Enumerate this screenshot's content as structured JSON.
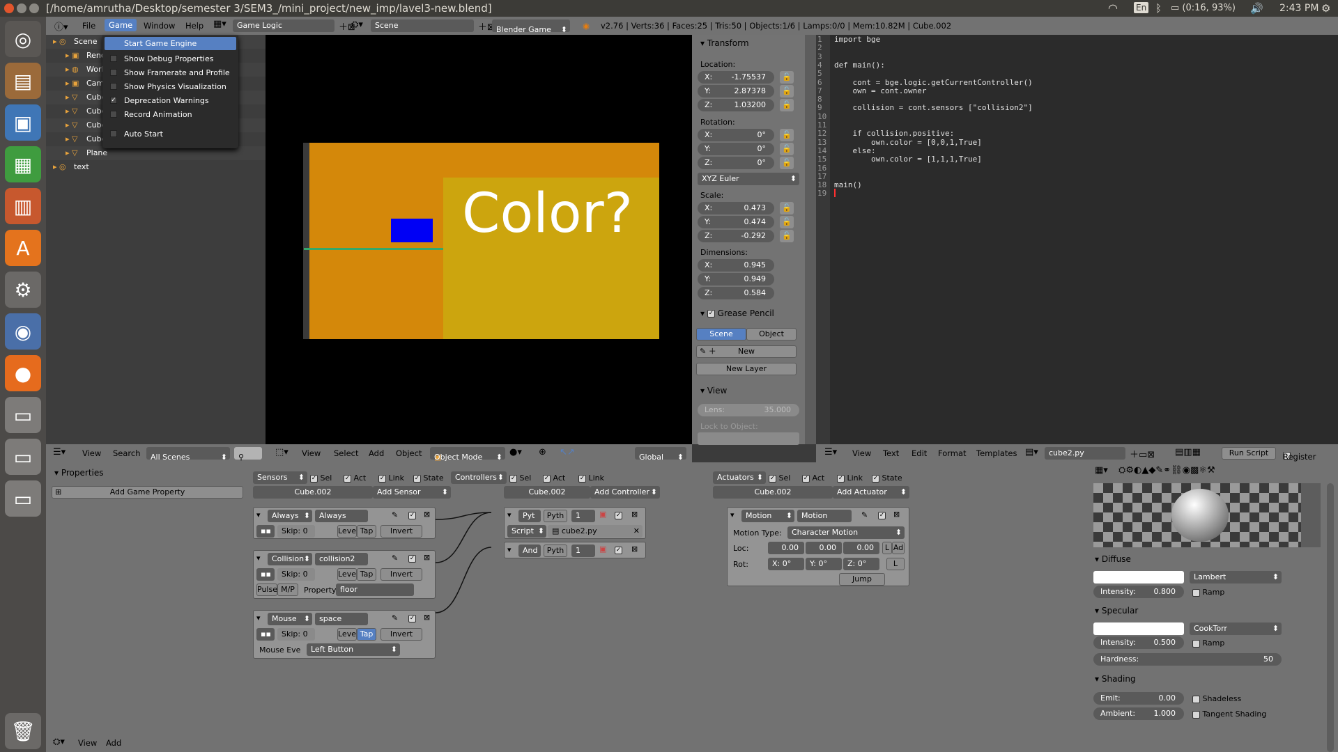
{
  "window": {
    "title": "[/home/amrutha/Desktop/semester 3/SEM3_/mini_project/new_imp/lavel3-new.blend]"
  },
  "tray": {
    "lang": "En",
    "battery": "(0:16, 93%)",
    "time": "2:43 PM"
  },
  "info_header": {
    "menus": [
      "File",
      "Game",
      "Window",
      "Help"
    ],
    "layout": "Game Logic",
    "scene": "Scene",
    "engine": "Blender Game",
    "stats": "v2.76 | Verts:36 | Faces:25 | Tris:50 | Objects:1/6 | Lamps:0/0 | Mem:10.82M | Cube.002"
  },
  "game_menu": {
    "items": [
      {
        "label": "Start Game Engine",
        "check": "none",
        "highlight": true
      },
      {
        "label": "Show Debug Properties",
        "check": "off"
      },
      {
        "label": "Show Framerate and Profile",
        "check": "off"
      },
      {
        "label": "Show Physics Visualization",
        "check": "off"
      },
      {
        "label": "Deprecation Warnings",
        "check": "on"
      },
      {
        "label": "Record Animation",
        "check": "off"
      },
      {
        "label": "Auto Start",
        "check": "off"
      }
    ]
  },
  "outliner": {
    "rows": [
      "Scene",
      "Rend",
      "Worl",
      "Cam",
      "Cube",
      "Cube",
      "Cube",
      "Cube",
      "Plane",
      "text"
    ],
    "footer": {
      "view": "View",
      "search": "Search",
      "filter": "All Scenes"
    }
  },
  "viewport": {
    "text": "Color?",
    "footer": {
      "view": "View",
      "select": "Select",
      "add": "Add",
      "object": "Object",
      "mode": "Object Mode",
      "orientation": "Global"
    }
  },
  "properties_n": {
    "transform_title": "Transform",
    "location_label": "Location:",
    "location": [
      {
        "axis": "X:",
        "value": "-1.75537"
      },
      {
        "axis": "Y:",
        "value": "2.87378"
      },
      {
        "axis": "Z:",
        "value": "1.03200"
      }
    ],
    "rotation_label": "Rotation:",
    "rotation": [
      {
        "axis": "X:",
        "value": "0°"
      },
      {
        "axis": "Y:",
        "value": "0°"
      },
      {
        "axis": "Z:",
        "value": "0°"
      }
    ],
    "rotation_mode": "XYZ Euler",
    "scale_label": "Scale:",
    "scale": [
      {
        "axis": "X:",
        "value": "0.473"
      },
      {
        "axis": "Y:",
        "value": "0.474"
      },
      {
        "axis": "Z:",
        "value": "-0.292"
      }
    ],
    "dimensions_label": "Dimensions:",
    "dimensions": [
      {
        "axis": "X:",
        "value": "0.945"
      },
      {
        "axis": "Y:",
        "value": "0.949"
      },
      {
        "axis": "Z:",
        "value": "0.584"
      }
    ],
    "grease_title": "Grease Pencil",
    "scene_btn": "Scene",
    "object_btn": "Object",
    "new_btn": "New",
    "new_layer_btn": "New Layer",
    "view_title": "View",
    "lens_label": "Lens:",
    "lens_value": "35.000",
    "lock_label": "Lock to Object:"
  },
  "text_editor": {
    "lines": [
      "import bge",
      "",
      "",
      "def main():",
      "",
      "    cont = bge.logic.getCurrentController()",
      "    own = cont.owner",
      "",
      "    collision = cont.sensors [\"collision2\"]",
      "",
      "",
      "    if collision.positive:",
      "        own.color = [0,0,1,True]",
      "    else:",
      "        own.color = [1,1,1,True]",
      "",
      "",
      "main()",
      ""
    ],
    "footer": {
      "view": "View",
      "text": "Text",
      "edit": "Edit",
      "format": "Format",
      "templates": "Templates",
      "filename": "cube2.py",
      "run": "Run Script",
      "register": "Register"
    }
  },
  "game_props": {
    "title": "Properties",
    "add": "Add Game Property",
    "footer": {
      "view": "View",
      "add": "Add"
    }
  },
  "logic": {
    "sensors_header": {
      "label": "Sensors",
      "sel": "Sel",
      "act": "Act",
      "link": "Link",
      "state": "State",
      "object": "Cube.002",
      "add": "Add Sensor"
    },
    "sensors": [
      {
        "type": "Always",
        "name": "Always",
        "skip": "Skip:",
        "skip_value": "0",
        "level": "Level",
        "tap": "Tap",
        "invert": "Invert"
      },
      {
        "type": "Collision",
        "name": "collision2",
        "skip": "Skip:",
        "skip_value": "0",
        "level": "Level",
        "tap": "Tap",
        "invert": "Invert",
        "pulse": "Pulse",
        "mp": "M/P",
        "property_label": "Property:",
        "property_value": "floor"
      },
      {
        "type": "Mouse",
        "name": "space",
        "skip": "Skip:",
        "skip_value": "0",
        "level": "Level",
        "tap": "Tap",
        "invert": "Invert",
        "event_label": "Mouse Eve",
        "event_value": "Left Button"
      }
    ],
    "controllers_header": {
      "label": "Controllers",
      "sel": "Sel",
      "act": "Act",
      "link": "Link",
      "object": "Cube.002",
      "add": "Add Controller"
    },
    "controllers": [
      {
        "type": "Pyt",
        "name": "Pyth",
        "state": "1",
        "mode": "Script",
        "script": "cube2.py"
      },
      {
        "type": "And",
        "name": "Pyth",
        "state": "1"
      }
    ],
    "actuators_header": {
      "label": "Actuators",
      "sel": "Sel",
      "act": "Act",
      "link": "Link",
      "state": "State",
      "object": "Cube.002",
      "add": "Add Actuator"
    },
    "actuator": {
      "type": "Motion",
      "name": "Motion",
      "motion_type_label": "Motion Type:",
      "motion_type": "Character Motion",
      "loc_label": "Loc:",
      "loc": [
        "0.00",
        "0.00",
        "0.00"
      ],
      "rot_label": "Rot:",
      "rot": [
        {
          "axis": "X:",
          "value": "0°"
        },
        {
          "axis": "Y:",
          "value": "0°"
        },
        {
          "axis": "Z:",
          "value": "0°"
        }
      ],
      "l1": "L",
      "l2": "Ad",
      "l3": "L",
      "jump": "Jump"
    }
  },
  "material": {
    "diffuse_title": "Diffuse",
    "diffuse_shader": "Lambert",
    "intensity_label": "Intensity:",
    "diffuse_intensity": "0.800",
    "ramp": "Ramp",
    "specular_title": "Specular",
    "specular_shader": "CookTorr",
    "specular_intensity": "0.500",
    "hardness_label": "Hardness:",
    "hardness": "50",
    "shading_title": "Shading",
    "emit_label": "Emit:",
    "emit": "0.00",
    "ambient_label": "Ambient:",
    "ambient": "1.000",
    "shadeless": "Shadeless",
    "tangent": "Tangent Shading"
  }
}
